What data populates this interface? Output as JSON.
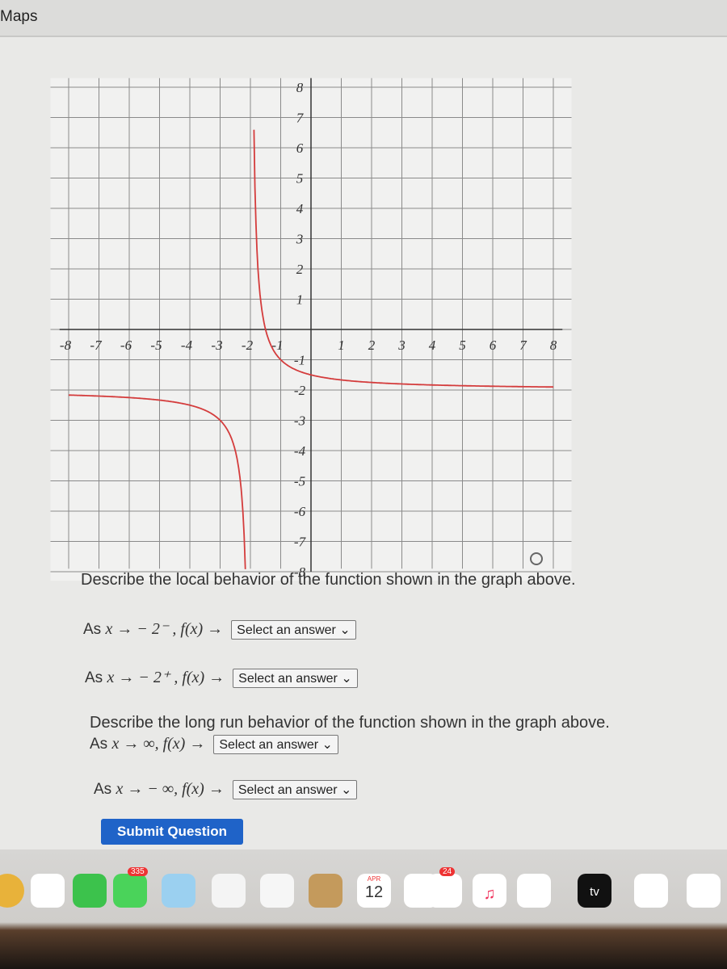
{
  "menubar": {
    "app_name": "Maps"
  },
  "chart_data": {
    "type": "line",
    "function": "f(x) = 1/(x+2) - 2",
    "vertical_asymptote": -2,
    "horizontal_asymptote": -2,
    "xlim": [
      -8,
      8
    ],
    "ylim": [
      -8,
      8
    ],
    "x_ticks": [
      "-8",
      "-7",
      "-6",
      "-5",
      "-4",
      "-3",
      "-2",
      "-1",
      "1",
      "2",
      "3",
      "4",
      "5",
      "6",
      "7",
      "8"
    ],
    "y_ticks": [
      "8",
      "7",
      "6",
      "5",
      "4",
      "3",
      "2",
      "1",
      "-1",
      "-2",
      "-3",
      "-4",
      "-5",
      "-6",
      "-7",
      "-8"
    ],
    "grid": true,
    "line_color": "#d43c3c"
  },
  "question": {
    "local_heading": "Describe the local behavior of the function shown in the graph above.",
    "long_heading": "Describe the long run behavior of the function shown in the graph above.",
    "rows": [
      {
        "prefix": "As ",
        "expr": "x → − 2⁻ , f(x) →",
        "select": "Select an answer"
      },
      {
        "prefix": "As ",
        "expr": "x → − 2⁺ , f(x) →",
        "select": "Select an answer"
      },
      {
        "prefix": "As ",
        "expr": "x → ∞, f(x) →",
        "select": "Select an answer"
      },
      {
        "prefix": "As ",
        "expr": "x → − ∞, f(x) →",
        "select": "Select an answer"
      }
    ],
    "submit_label": "Submit Question",
    "accent_color": "#1f63c8"
  },
  "dock": {
    "messages_badge": "335",
    "calendar_month": "APR",
    "calendar_day": "12",
    "reminders_badge": "24",
    "tv_label": "tv"
  }
}
